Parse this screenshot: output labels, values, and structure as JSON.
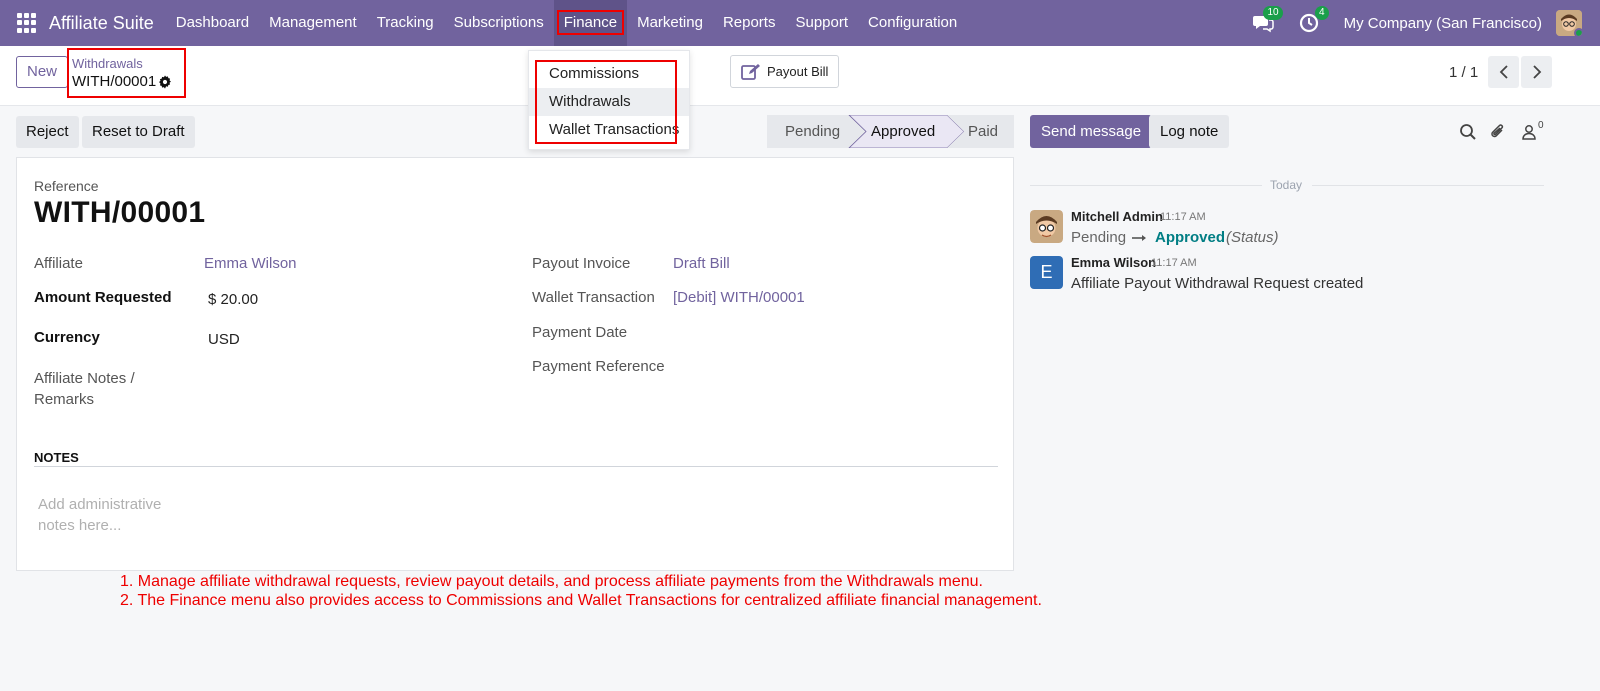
{
  "navbar": {
    "brand": "Affiliate Suite",
    "menu": [
      "Dashboard",
      "Management",
      "Tracking",
      "Subscriptions",
      "Finance",
      "Marketing",
      "Reports",
      "Support",
      "Configuration"
    ],
    "active": "Finance",
    "messages_badge": "10",
    "activities_badge": "4",
    "company": "My Company (San Francisco)"
  },
  "control_panel": {
    "new_label": "New",
    "breadcrumb_parent": "Withdrawals",
    "breadcrumb_current": "WITH/00001",
    "payout_bill_label": "Payout Bill",
    "pager": "1 / 1"
  },
  "finance_dropdown": {
    "items": [
      "Commissions",
      "Withdrawals",
      "Wallet Transactions"
    ],
    "selected": "Withdrawals"
  },
  "actions": {
    "reject": "Reject",
    "reset_to_draft": "Reset to Draft"
  },
  "statusbar": {
    "stages": [
      "Pending",
      "Approved",
      "Paid"
    ],
    "current": "Approved"
  },
  "form": {
    "reference_label": "Reference",
    "reference": "WITH/00001",
    "affiliate_label": "Affiliate",
    "affiliate": "Emma Wilson",
    "amount_label": "Amount Requested",
    "amount": "$ 20.00",
    "currency_label": "Currency",
    "currency": "USD",
    "notes_label": "Affiliate Notes / Remarks",
    "payout_invoice_label": "Payout Invoice",
    "payout_invoice": "Draft Bill",
    "wallet_tx_label": "Wallet Transaction",
    "wallet_tx": "[Debit] WITH/00001",
    "payment_date_label": "Payment Date",
    "payment_ref_label": "Payment Reference",
    "notes_section": "NOTES",
    "notes_placeholder": "Add administrative notes here..."
  },
  "chatter": {
    "send_message": "Send message",
    "log_note": "Log note",
    "followers_count": "0",
    "date_separator": "Today",
    "messages": [
      {
        "author": "Mitchell Admin",
        "time": "11:17 AM",
        "from": "Pending",
        "to": "Approved",
        "field": "(Status)"
      },
      {
        "author": "Emma Wilson",
        "initial": "E",
        "time": "11:17 AM",
        "body": "Affiliate Payout Withdrawal Request created"
      }
    ]
  },
  "annotations": [
    "1. Manage affiliate withdrawal requests, review payout details, and process affiliate payments from the Withdrawals menu.",
    "2. The Finance menu also provides access to Commissions and Wallet Transactions for centralized affiliate financial management."
  ],
  "colors": {
    "brand": "#71639e",
    "badge": "#1a9f4a",
    "highlight": "#ee0000",
    "status_link": "#017e84"
  }
}
